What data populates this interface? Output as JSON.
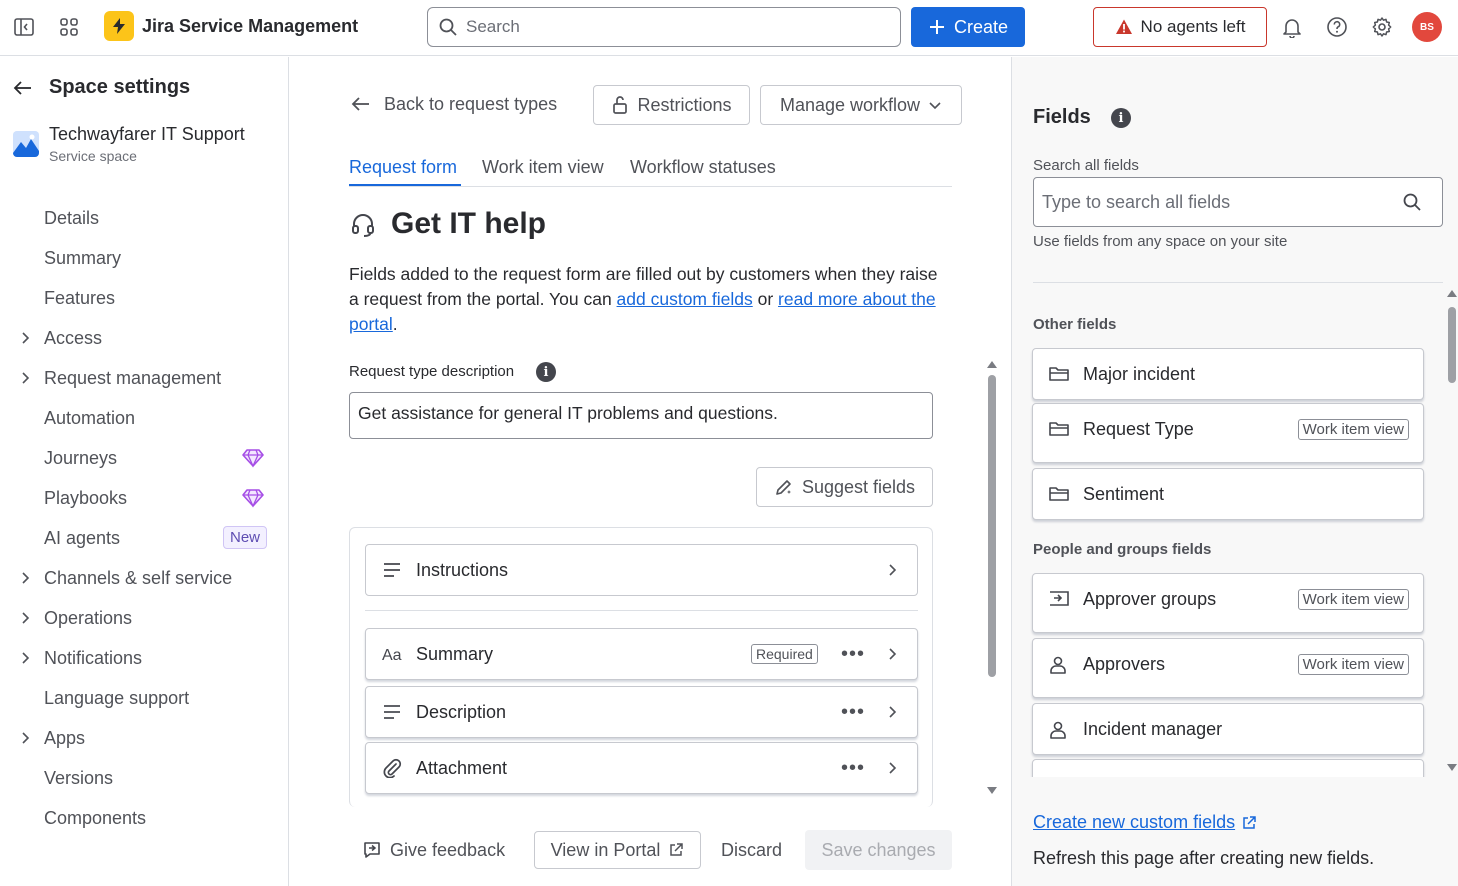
{
  "topbar": {
    "app_name": "Jira Service Management",
    "search_placeholder": "Search",
    "create_label": "Create",
    "agents_label": "No agents left",
    "avatar_initials": "BS",
    "brand_color": "#1868db",
    "logo_color": "#fcc419"
  },
  "sidebar": {
    "title": "Space settings",
    "space_name": "Techwayfarer IT Support",
    "space_type": "Service space",
    "items": [
      {
        "label": "Details",
        "expandable": false
      },
      {
        "label": "Summary",
        "expandable": false
      },
      {
        "label": "Features",
        "expandable": false
      },
      {
        "label": "Access",
        "expandable": true
      },
      {
        "label": "Request management",
        "expandable": true
      },
      {
        "label": "Automation",
        "expandable": false
      },
      {
        "label": "Journeys",
        "expandable": false,
        "badge": "gem-icon"
      },
      {
        "label": "Playbooks",
        "expandable": false,
        "badge": "gem-icon"
      },
      {
        "label": "AI agents",
        "expandable": false,
        "badge_text": "New"
      },
      {
        "label": "Channels & self service",
        "expandable": true
      },
      {
        "label": "Operations",
        "expandable": true
      },
      {
        "label": "Notifications",
        "expandable": true
      },
      {
        "label": "Language support",
        "expandable": false
      },
      {
        "label": "Apps",
        "expandable": true
      },
      {
        "label": "Versions",
        "expandable": false
      },
      {
        "label": "Components",
        "expandable": false
      }
    ]
  },
  "main": {
    "back_label": "Back to request types",
    "restrictions_label": "Restrictions",
    "workflow_label": "Manage workflow",
    "tabs": [
      "Request form",
      "Work item view",
      "Workflow statuses"
    ],
    "active_tab": "Request form",
    "title": "Get IT help",
    "intro_text_1": "Fields added to the request form are filled out by customers when they raise a request from the portal. You can ",
    "intro_link_1": "add custom fields",
    "intro_text_2": " or ",
    "intro_link_2": "read more about the portal",
    "intro_text_3": ".",
    "desc_label": "Request type description",
    "desc_value": "Get assistance for general IT problems and questions.",
    "suggest_label": "Suggest fields",
    "fields": [
      {
        "name": "Instructions",
        "icon": "lines-icon",
        "required": false,
        "menu": false
      },
      {
        "name": "Summary",
        "icon": "text-icon",
        "required": true,
        "menu": true
      },
      {
        "name": "Description",
        "icon": "lines-icon",
        "required": false,
        "menu": true
      },
      {
        "name": "Attachment",
        "icon": "paperclip-icon",
        "required": false,
        "menu": true
      }
    ],
    "required_label": "Required",
    "footer": {
      "feedback_label": "Give feedback",
      "portal_label": "View in Portal",
      "discard_label": "Discard",
      "save_label": "Save changes"
    }
  },
  "fields_panel": {
    "title": "Fields",
    "search_label": "Search all fields",
    "search_placeholder": "Type to search all fields",
    "help_text": "Use fields from any space on your site",
    "groups": [
      {
        "heading": "Other fields",
        "items": [
          {
            "name": "Major incident",
            "icon": "folder-icon",
            "tag": ""
          },
          {
            "name": "Request Type",
            "icon": "folder-icon",
            "tag": "Work item view"
          },
          {
            "name": "Sentiment",
            "icon": "folder-icon",
            "tag": ""
          }
        ]
      },
      {
        "heading": "People and groups fields",
        "items": [
          {
            "name": "Approver groups",
            "icon": "group-icon",
            "tag": "Work item view"
          },
          {
            "name": "Approvers",
            "icon": "person-icon",
            "tag": "Work item view"
          },
          {
            "name": "Incident manager",
            "icon": "person-icon",
            "tag": ""
          }
        ]
      }
    ],
    "create_link": "Create new custom fields",
    "refresh_note": "Refresh this page after creating new fields."
  }
}
